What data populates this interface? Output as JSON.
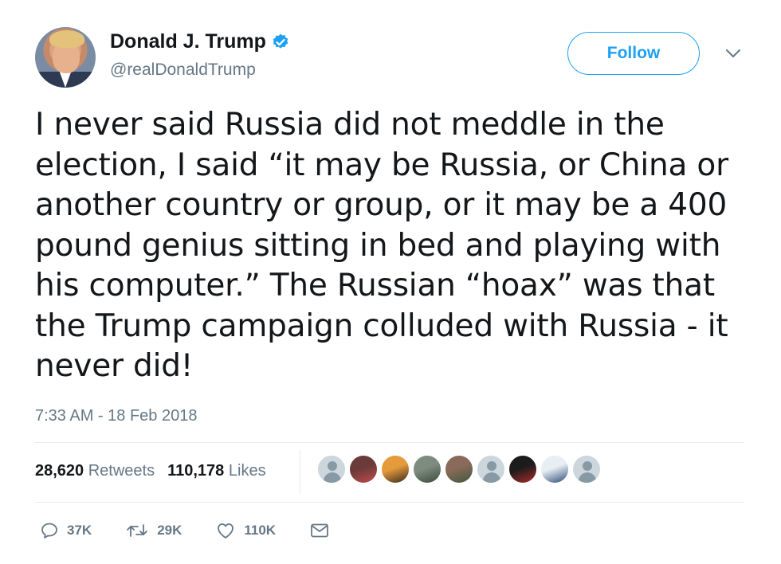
{
  "author": {
    "display_name": "Donald J. Trump",
    "handle": "@realDonaldTrump",
    "verified": true
  },
  "header": {
    "follow_label": "Follow"
  },
  "tweet": {
    "text": "I never said Russia did not meddle in the\nelection, I said “it may be Russia, or China or\nanother country or group, or it may be a 400\npound genius sitting in bed and playing with\nhis computer.” The Russian “hoax” was that\nthe Trump campaign colluded with Russia - it\nnever did!",
    "timestamp": "7:33 AM - 18 Feb 2018"
  },
  "stats": {
    "retweets_count": "28,620",
    "retweets_label": "Retweets",
    "likes_count": "110,178",
    "likes_label": "Likes"
  },
  "likers": [
    {
      "type": "default"
    },
    {
      "type": "photo",
      "colors": [
        "#6b3a3a",
        "#c44a4a"
      ]
    },
    {
      "type": "photo",
      "colors": [
        "#e59b3c",
        "#3a2a1c"
      ]
    },
    {
      "type": "photo",
      "colors": [
        "#7e8c80",
        "#3c4a3e"
      ]
    },
    {
      "type": "photo",
      "colors": [
        "#8a6a5a",
        "#3c5a3c"
      ]
    },
    {
      "type": "default"
    },
    {
      "type": "photo",
      "colors": [
        "#1c1c1c",
        "#b02a2a"
      ]
    },
    {
      "type": "photo",
      "colors": [
        "#e8eef2",
        "#2c4a7a"
      ]
    },
    {
      "type": "default"
    }
  ],
  "actions": {
    "reply_count": "37K",
    "retweet_count": "29K",
    "like_count": "110K"
  },
  "colors": {
    "accent": "#1da1f2",
    "secondary_text": "#657786",
    "primary_text": "#14171a",
    "divider": "#e6ecf0"
  },
  "icons": {
    "verified": "verified-badge-icon",
    "menu": "chevron-down-icon",
    "reply": "reply-icon",
    "retweet": "retweet-icon",
    "like": "heart-icon",
    "message": "envelope-icon"
  }
}
